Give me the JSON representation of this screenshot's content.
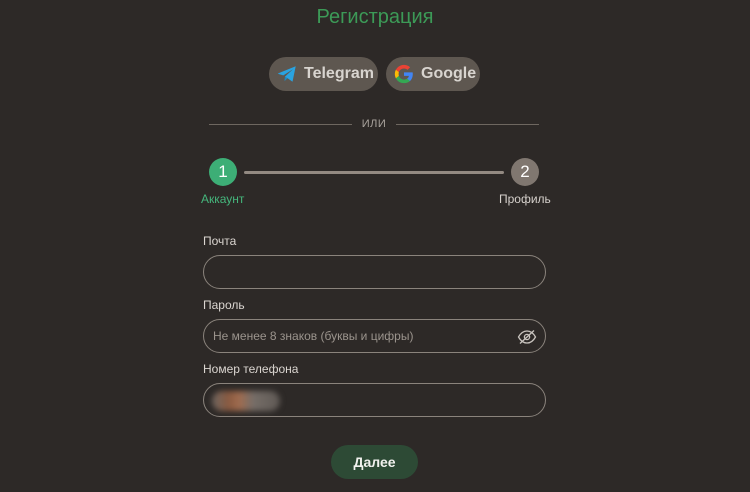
{
  "title": "Регистрация",
  "social": {
    "telegram_label": "Telegram",
    "google_label": "Google"
  },
  "divider_text": "ИЛИ",
  "steps": [
    {
      "number": "1",
      "label": "Аккаунт",
      "active": true
    },
    {
      "number": "2",
      "label": "Профиль",
      "active": false
    }
  ],
  "form": {
    "email_label": "Почта",
    "email_value": "",
    "password_label": "Пароль",
    "password_placeholder": "Не менее 8 знаков (буквы и цифры)",
    "phone_label": "Номер телефона",
    "phone_value": ""
  },
  "next_button": "Далее",
  "colors": {
    "background": "#2d2927",
    "title_green": "#3c9a57",
    "active_step": "#3dae76",
    "inactive_step": "#807770",
    "social_button": "#5e5750",
    "next_button": "#2d4a35"
  },
  "icons": {
    "telegram": "telegram-icon",
    "google": "google-icon",
    "password_toggle": "eye-slash-icon"
  }
}
